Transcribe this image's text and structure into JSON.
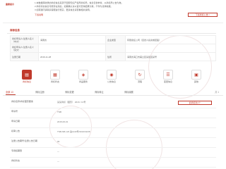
{
  "notice": {
    "label": "重要提示",
    "lines": [
      "1.本数据库收录的商标信息来源于国家知识产权局商标局，信息仅供参考，以商标局公告为准。",
      "2.商标状态信息可能存在滞后，如需确认请以官方查询结果为准，不作为法律依据。",
      "3.如有疑问请联系客服进行核实，更多信息请查看相关说明。"
    ],
    "link_text": "下载说明",
    "button_label": "下载商标公告 >"
  },
  "section": {
    "title": "商标信息"
  },
  "registration": {
    "rows": [
      [
        "商标申请人/注册人名义（中文）",
        "海南省",
        "企业类型",
        "有限责任公司（自然人投资或控股）"
      ],
      [
        "商标申请人/注册人名义（英文）",
        "",
        "",
        ""
      ],
      [
        "注册日期",
        "2016-11-28",
        "住所",
        "海南省海口市美兰区某街道某号"
      ]
    ]
  },
  "icon_tabs": [
    {
      "label": "商标信息",
      "icon": "document-icon",
      "glyph": "▤"
    },
    {
      "label": "商标状态",
      "icon": "clipboard-icon",
      "glyph": "▦"
    },
    {
      "label": "商品服务",
      "icon": "tag-icon",
      "glyph": "◈"
    },
    {
      "label": "公告信息",
      "icon": "bell-icon",
      "glyph": "◉"
    },
    {
      "label": "流程",
      "icon": "flow-icon",
      "glyph": "↻"
    },
    {
      "label": "变更信息",
      "icon": "list-icon",
      "glyph": "☰"
    },
    {
      "label": "其他",
      "icon": "grid-icon",
      "glyph": "▣"
    }
  ],
  "result_tabs": {
    "items": [
      "全部 13",
      "商标注册",
      "商标变更",
      "商标转让",
      "商标续展"
    ],
    "pager": "共 1"
  },
  "details": {
    "pill_label": "此商标共1个",
    "rows": [
      {
        "k": "商标名称/商标图形要素",
        "v": "某某商标（图形）  2016 / 13号"
      },
      {
        "k": "申请号",
        "v": "TNB"
      },
      {
        "k": "申请日期",
        "v": "2015-06-01"
      },
      {
        "k": "初审公告",
        "v": "TNB-NB-123  第1440号/2016/02/28"
      },
      {
        "k": "注册公告期号/注册公告日期",
        "v": "00"
      },
      {
        "k": "专用权期限",
        "v": "—"
      },
      {
        "k": "商标状态",
        "v": "—"
      }
    ]
  },
  "colors": {
    "accent": "#c0392b"
  }
}
